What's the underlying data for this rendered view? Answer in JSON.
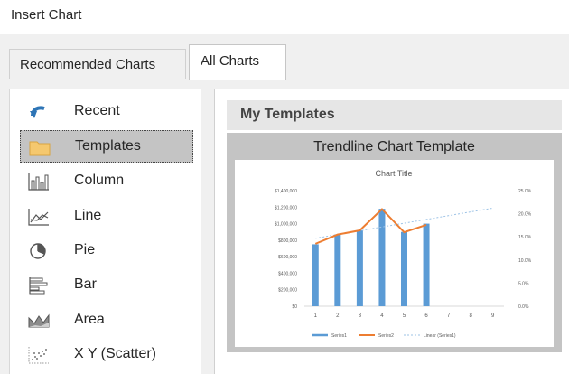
{
  "dialog": {
    "title": "Insert Chart"
  },
  "tabs": [
    {
      "label": "Recommended Charts",
      "active": false
    },
    {
      "label": "All Charts",
      "active": true
    }
  ],
  "categories": [
    {
      "label": "Recent",
      "icon": "recent-icon",
      "selected": false
    },
    {
      "label": "Templates",
      "icon": "folder-icon",
      "selected": true
    },
    {
      "label": "Column",
      "icon": "column-chart-icon",
      "selected": false
    },
    {
      "label": "Line",
      "icon": "line-chart-icon",
      "selected": false
    },
    {
      "label": "Pie",
      "icon": "pie-chart-icon",
      "selected": false
    },
    {
      "label": "Bar",
      "icon": "bar-chart-icon",
      "selected": false
    },
    {
      "label": "Area",
      "icon": "area-chart-icon",
      "selected": false
    },
    {
      "label": "X Y (Scatter)",
      "icon": "scatter-chart-icon",
      "selected": false
    }
  ],
  "section_header": "My Templates",
  "template": {
    "name": "Trendline Chart Template"
  },
  "colors": {
    "series1": "#5b9bd5",
    "series2": "#ed7d31",
    "linear": "#9dc3e6",
    "selected_bg": "#c4c4c4",
    "folder": "#f5c86e"
  },
  "chart_data": {
    "type": "bar",
    "title": "Chart Title",
    "categories": [
      "1",
      "2",
      "3",
      "4",
      "5",
      "6",
      "7",
      "8",
      "9"
    ],
    "y_ticks": [
      "$0",
      "$200,000",
      "$400,000",
      "$600,000",
      "$800,000",
      "$1,000,000",
      "$1,200,000",
      "$1,400,000"
    ],
    "y2_ticks": [
      "0.0%",
      "5.0%",
      "10.0%",
      "15.0%",
      "20.0%",
      "25.0%"
    ],
    "ylim": [
      0,
      1400000
    ],
    "y2lim": [
      0,
      25
    ],
    "series": [
      {
        "name": "Series1",
        "type": "bar",
        "axis": "primary",
        "values": [
          750000,
          870000,
          920000,
          1180000,
          900000,
          1000000
        ]
      },
      {
        "name": "Series2",
        "type": "line",
        "axis": "secondary",
        "values": [
          13.5,
          15.5,
          16.4,
          21.0,
          16.0,
          17.6
        ]
      },
      {
        "name": "Linear (Series1)",
        "type": "trendline",
        "axis": "primary",
        "values": []
      }
    ],
    "legend": "bottom",
    "grid": false
  }
}
